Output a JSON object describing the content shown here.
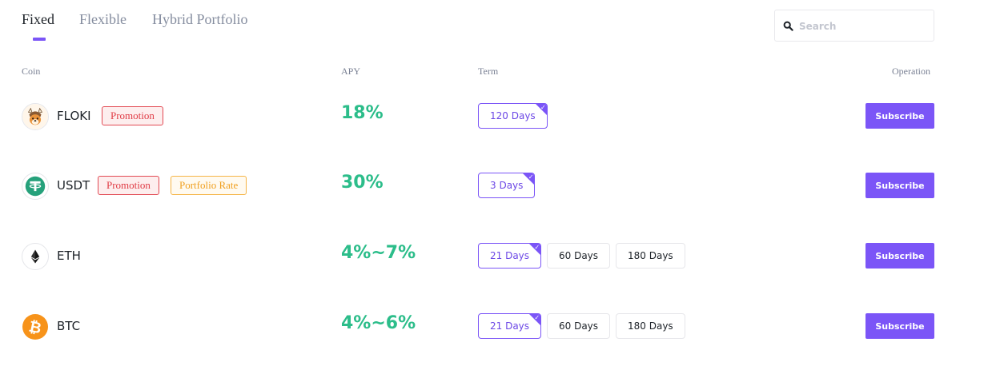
{
  "tabs": [
    {
      "label": "Fixed",
      "active": true
    },
    {
      "label": "Flexible",
      "active": false
    },
    {
      "label": "Hybrid Portfolio",
      "active": false
    }
  ],
  "search": {
    "placeholder": "Search",
    "value": ""
  },
  "columns": {
    "coin": "Coin",
    "apy": "APY",
    "term": "Term",
    "operation": "Operation"
  },
  "colors": {
    "accent": "#7b55f7",
    "apy_green": "#2cbd8a",
    "promotion_red": "#e03c46",
    "portfolio_orange": "#f0a020"
  },
  "rows": [
    {
      "coin": "FLOKI",
      "icon": "floki-icon",
      "badges": [
        "Promotion"
      ],
      "apy": "18%",
      "terms": [
        {
          "label": "120 Days",
          "selected": true
        }
      ],
      "action": "Subscribe"
    },
    {
      "coin": "USDT",
      "icon": "usdt-tether-icon",
      "badges": [
        "Promotion",
        "Portfolio Rate"
      ],
      "apy": "30%",
      "terms": [
        {
          "label": "3 Days",
          "selected": true
        }
      ],
      "action": "Subscribe"
    },
    {
      "coin": "ETH",
      "icon": "ethereum-icon",
      "badges": [],
      "apy": "4%~7%",
      "terms": [
        {
          "label": "21 Days",
          "selected": true
        },
        {
          "label": "60 Days",
          "selected": false
        },
        {
          "label": "180 Days",
          "selected": false
        }
      ],
      "action": "Subscribe"
    },
    {
      "coin": "BTC",
      "icon": "bitcoin-icon",
      "badges": [],
      "apy": "4%~6%",
      "terms": [
        {
          "label": "21 Days",
          "selected": true
        },
        {
          "label": "60 Days",
          "selected": false
        },
        {
          "label": "180 Days",
          "selected": false
        }
      ],
      "action": "Subscribe"
    }
  ]
}
